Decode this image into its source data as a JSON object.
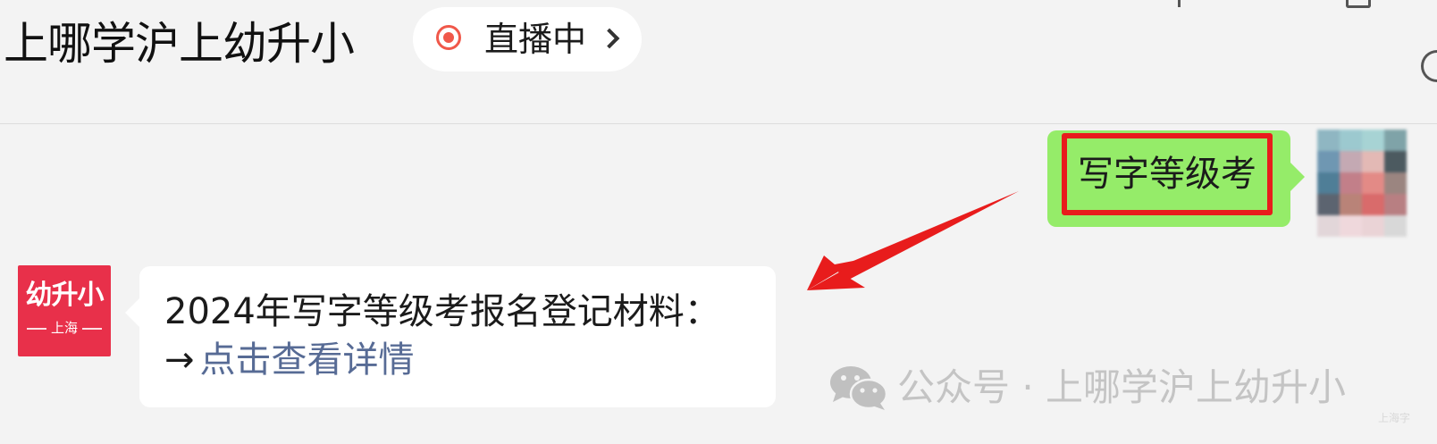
{
  "header": {
    "chat_title": "上哪学沪上幼升小",
    "live_label": "直播中"
  },
  "messages": {
    "outgoing": {
      "text": "写字等级考"
    },
    "incoming": {
      "avatar_name": "幼升小",
      "avatar_city": "上海",
      "line_1": "2024年写字等级考报名登记材料：",
      "arrow_glyph": "→",
      "link_text": "点击查看详情"
    }
  },
  "watermark": {
    "icon": "wechat-icon",
    "text": "公众号 · 上哪学沪上幼升小",
    "corner_stamp": "上海字"
  },
  "colors": {
    "page_background": "#f3f3f3",
    "outgoing_bubble": "#95ec69",
    "incoming_bubble": "#ffffff",
    "link": "#576b95",
    "live_indicator": "#f0584a",
    "highlight_box": "#e81c1c",
    "annotation_arrow": "#e81c1c",
    "official_avatar": "#e8304a"
  },
  "icons": {
    "live": "live-record-icon",
    "chevron": "chevron-right-icon",
    "annotation": "annotation-arrow-icon"
  }
}
